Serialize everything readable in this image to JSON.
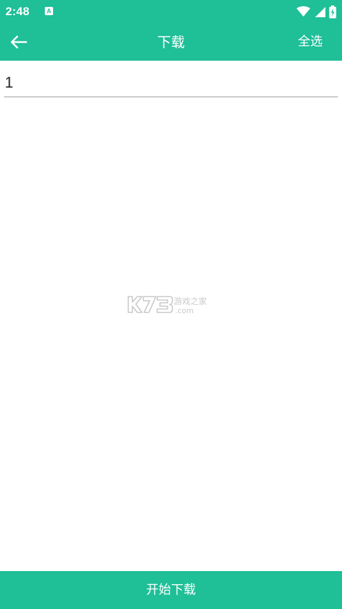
{
  "status_bar": {
    "time": "2:48",
    "notification_badge": "A",
    "icons": [
      "wifi-icon",
      "signal-icon",
      "battery-charging-icon"
    ]
  },
  "app_bar": {
    "title": "下载",
    "select_all_label": "全选",
    "back_icon": "arrow-left-icon"
  },
  "list": {
    "items": [
      {
        "label": "1"
      }
    ]
  },
  "watermark": {
    "brand": "K73",
    "tagline": "游戏之家",
    "domain": ".com"
  },
  "footer": {
    "start_download_label": "开始下载"
  },
  "colors": {
    "accent": "#1fbf98",
    "background": "#ffffff",
    "divider": "#9e9e9e"
  }
}
